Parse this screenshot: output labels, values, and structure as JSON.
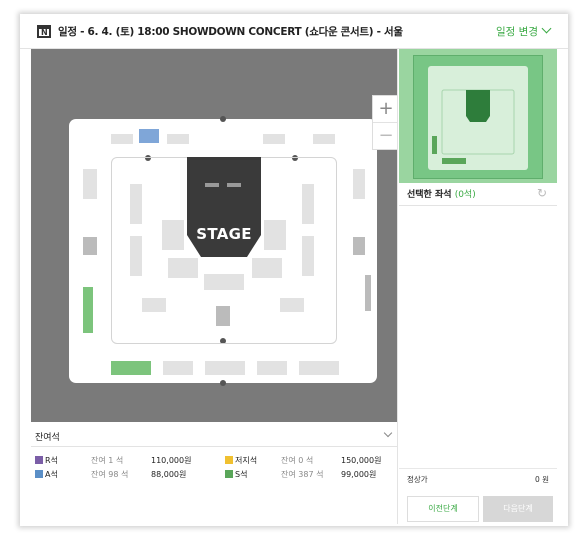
{
  "header": {
    "title": "일정 - 6. 4. (토) 18:00 SHOWDOWN CONCERT (쇼다운 콘서트) - 서울",
    "change_label": "일정 변경",
    "calendar_icon_letter": "N"
  },
  "map": {
    "stage_label": "STAGE",
    "zoom_in": "+",
    "zoom_out": "−"
  },
  "legend": {
    "title": "잔여석",
    "grades": [
      {
        "name": "R석",
        "remaining": "잔여 1 석",
        "price": "110,000원",
        "color": "#7b5ea7"
      },
      {
        "name": "A석",
        "remaining": "잔여 98 석",
        "price": "88,000원",
        "color": "#5b8fc7"
      },
      {
        "name": "저지석",
        "remaining": "잔여 0 석",
        "price": "150,000원",
        "color": "#f0c030"
      },
      {
        "name": "S석",
        "remaining": "잔여 387 석",
        "price": "99,000원",
        "color": "#5aa65a"
      }
    ]
  },
  "selection": {
    "title": "선택한 좌석",
    "count": "(0석)",
    "refresh_icon": "refresh-icon"
  },
  "summary": {
    "price_label": "정상가",
    "price_value": "0 원"
  },
  "buttons": {
    "prev": "이전단계",
    "next": "다음단계"
  },
  "colors": {
    "accent": "#3aaa44",
    "map_bg": "#7a7a7a",
    "stage": "#3a3a3a"
  }
}
